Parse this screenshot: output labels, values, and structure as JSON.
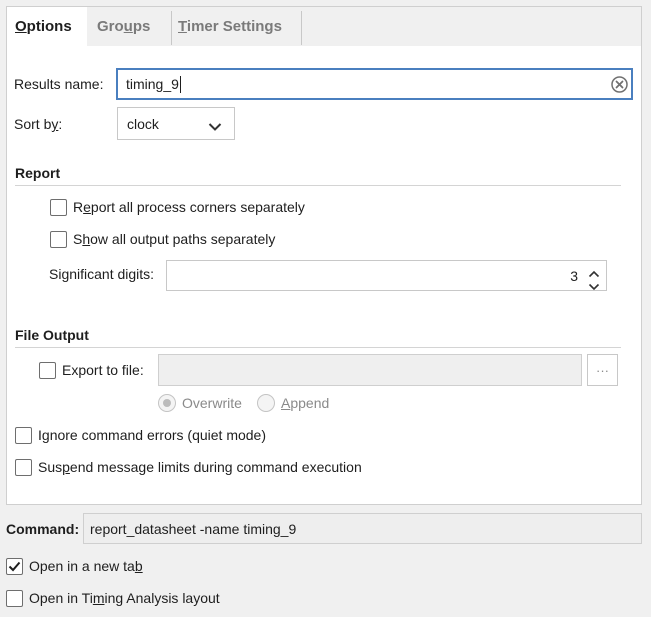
{
  "tabs": [
    {
      "label_pre": "",
      "label_u": "O",
      "label_post": "ptions"
    },
    {
      "label_pre": "Gro",
      "label_u": "u",
      "label_post": "ps"
    },
    {
      "label_pre": "",
      "label_u": "T",
      "label_post": "imer Settings"
    }
  ],
  "results_name": {
    "label": "Results name:",
    "value": "timing_9"
  },
  "sort_by": {
    "label_pre": "Sort b",
    "label_u": "y",
    "label_post": ":",
    "value": "clock"
  },
  "report": {
    "title": "Report",
    "corners": {
      "pre": "R",
      "u": "e",
      "post": "port all process corners separately",
      "checked": false
    },
    "paths": {
      "pre": "S",
      "u": "h",
      "post": "ow all output paths separately",
      "checked": false
    },
    "sig_digits": {
      "label": "Significant digits:",
      "value": "3"
    }
  },
  "file_output": {
    "title": "File Output",
    "export_label": "Export to file:",
    "export_checked": false,
    "export_value": "",
    "browse": "···",
    "overwrite": "Overwrite",
    "append_u": "A",
    "append_post": "ppend"
  },
  "ignore_errors": {
    "pre": "I",
    "u": "g",
    "post": "nore command errors (quiet mode)",
    "checked": false
  },
  "suspend_limits": {
    "pre": "Sus",
    "u": "p",
    "post": "end message limits during command execution",
    "checked": false
  },
  "command": {
    "label": "Command:",
    "value": "report_datasheet -name timing_9"
  },
  "open_new_tab": {
    "pre": "Open in a new ta",
    "u": "b",
    "post": "",
    "checked": true
  },
  "open_layout": {
    "pre": "Open in Ti",
    "u": "m",
    "post": "ing Analysis layout",
    "checked": false
  }
}
